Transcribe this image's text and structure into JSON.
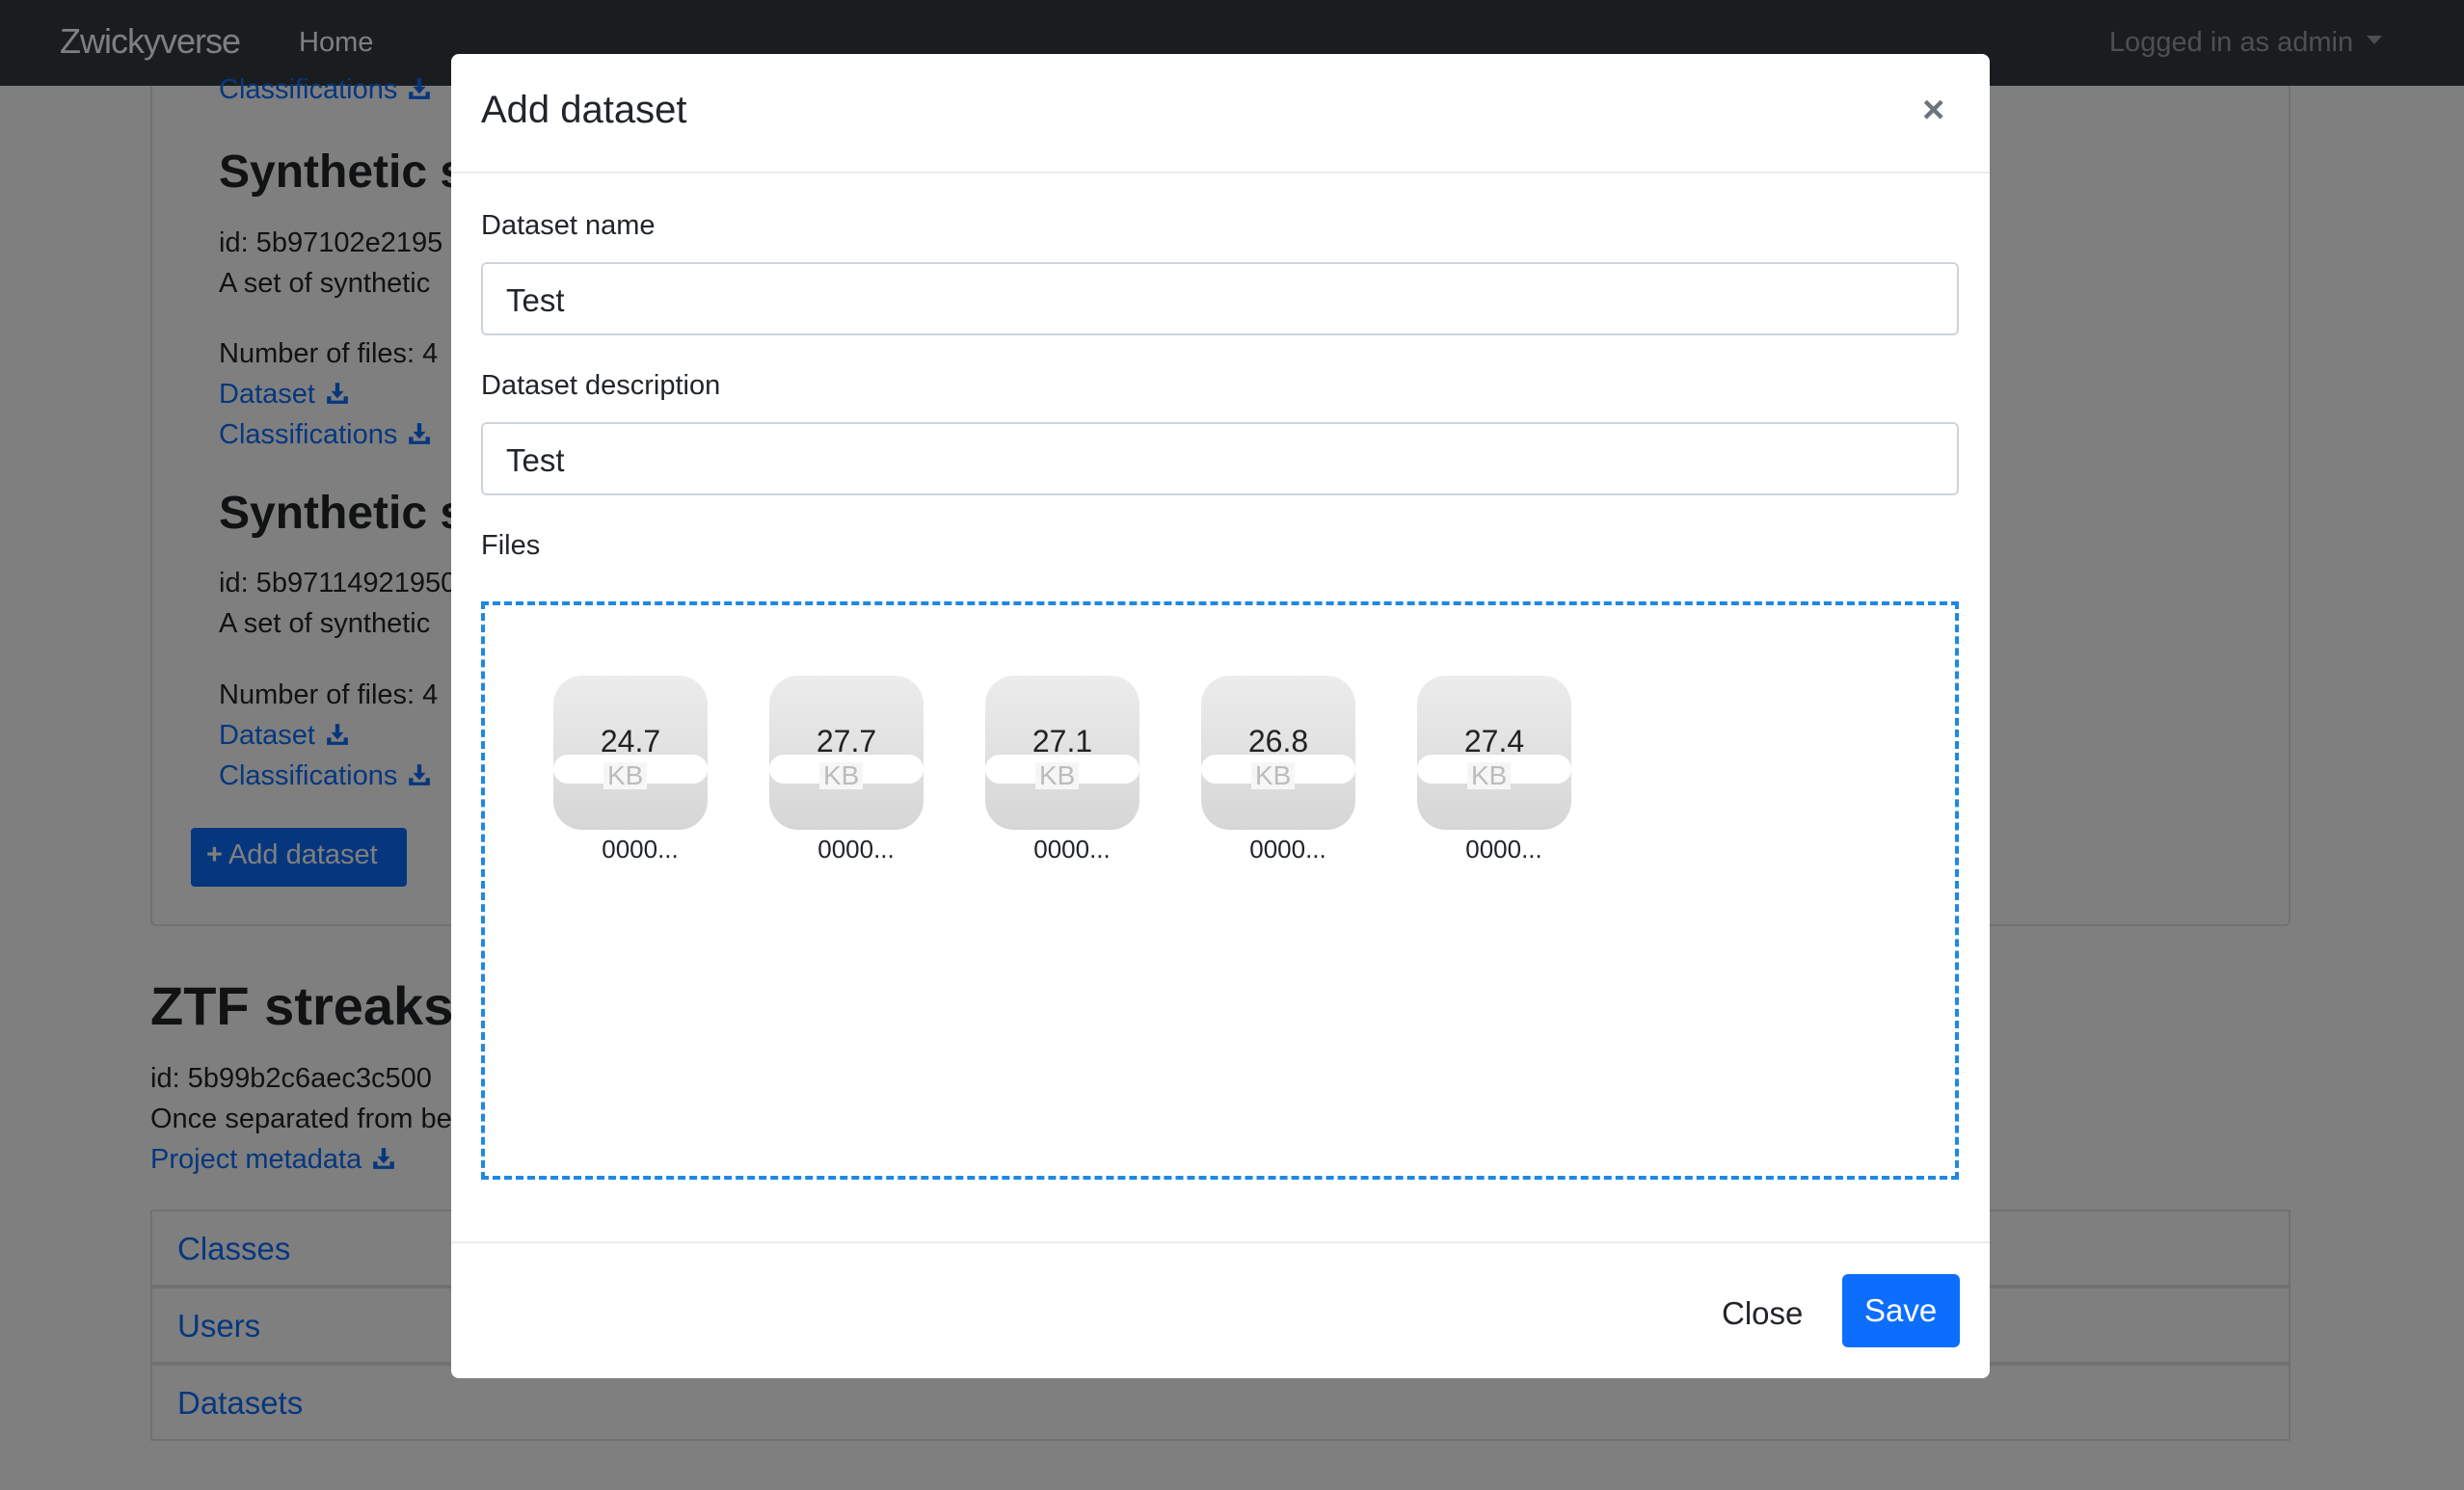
{
  "navbar": {
    "brand": "Zwickyverse",
    "home": "Home",
    "user": "Logged in as admin"
  },
  "background": {
    "classifications_top": "Classifications",
    "datasets": [
      {
        "title": "Synthetic st",
        "id": "id: 5b97102e2195",
        "description": "A set of synthetic",
        "files": "Number of files: 4",
        "dataset_link": "Dataset",
        "classifications_link": "Classifications"
      },
      {
        "title": "Synthetic st",
        "id": "id: 5b97114921950",
        "description": "A set of synthetic",
        "files": "Number of files: 4",
        "dataset_link": "Dataset",
        "classifications_link": "Classifications"
      }
    ],
    "add_dataset": "Add dataset",
    "project": {
      "title": "ZTF streaks:",
      "id": "id: 5b99b2c6aec3c500",
      "description": "Once separated from be",
      "metadata_link": "Project metadata"
    },
    "accordion": [
      "Classes",
      "Users",
      "Datasets"
    ]
  },
  "modal": {
    "title": "Add dataset",
    "close_glyph": "×",
    "name_label": "Dataset name",
    "name_value": "Test",
    "description_label": "Dataset description",
    "description_value": "Test",
    "files_label": "Files",
    "files": [
      {
        "size": "24.7",
        "unit": "KB",
        "name": "0000..."
      },
      {
        "size": "27.7",
        "unit": "KB",
        "name": "0000..."
      },
      {
        "size": "27.1",
        "unit": "KB",
        "name": "0000..."
      },
      {
        "size": "26.8",
        "unit": "KB",
        "name": "0000..."
      },
      {
        "size": "27.4",
        "unit": "KB",
        "name": "0000..."
      }
    ],
    "close_button": "Close",
    "save_button": "Save"
  },
  "colors": {
    "navbar": "#343a40",
    "link": "#0d6efd",
    "primary": "#0d6efd",
    "dropzone_border": "#1e88e5"
  },
  "icons": {
    "download": "download-icon",
    "plus": "plus-icon",
    "close": "close-icon",
    "caret": "caret-down-icon"
  }
}
